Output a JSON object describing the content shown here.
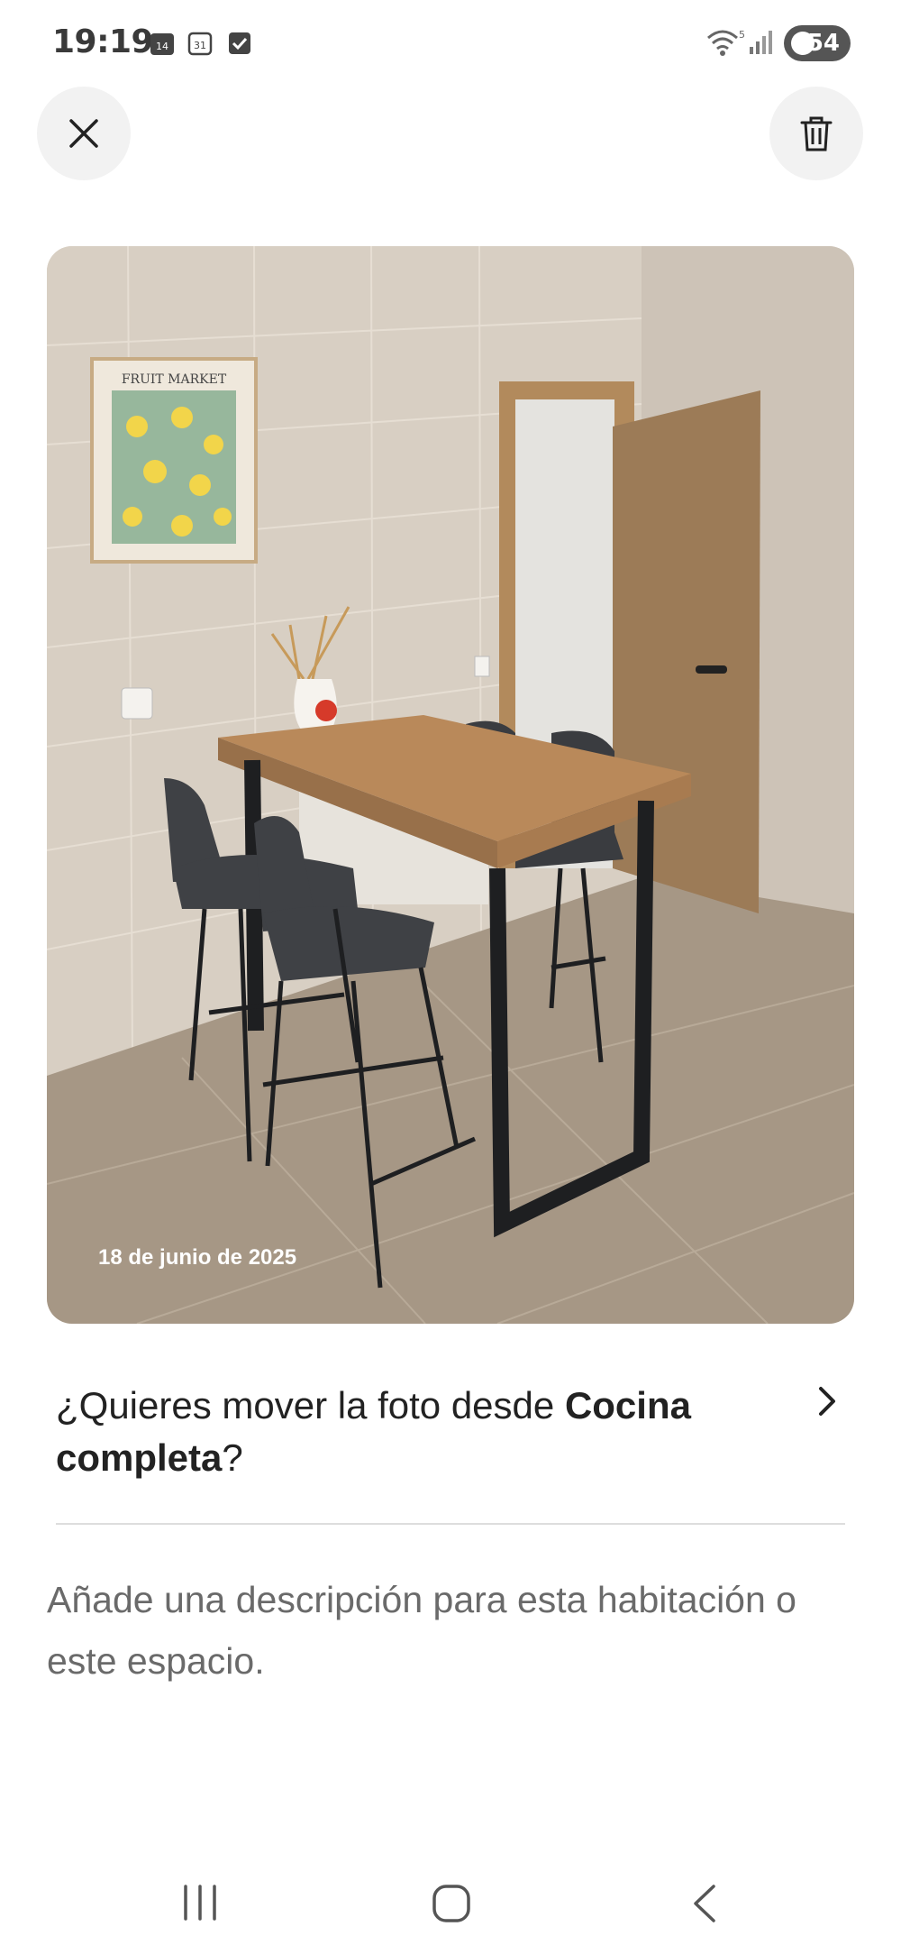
{
  "status_bar": {
    "time": "19:19",
    "notification_icons": [
      "calendar-14-icon",
      "calendar-31-icon",
      "checkbox-icon"
    ],
    "calendar_day_a": "14",
    "calendar_day_b": "31",
    "battery_level": "54"
  },
  "header": {
    "close_icon": "close-icon",
    "delete_icon": "trash-icon"
  },
  "photo": {
    "date_label": "18 de junio de 2025",
    "poster_text": "FRUIT MARKET"
  },
  "move": {
    "prefix": "¿Quieres mover la foto desde ",
    "room_name": "Cocina completa",
    "suffix": "?"
  },
  "description": {
    "placeholder": "Añade una descripción para esta habitación o este espacio."
  },
  "nav": {
    "icons": [
      "recent-apps-icon",
      "home-icon",
      "back-icon"
    ]
  },
  "colors": {
    "accent": "#222222",
    "muted_text": "#6a6a6a",
    "button_bg": "#f2f2f2"
  }
}
